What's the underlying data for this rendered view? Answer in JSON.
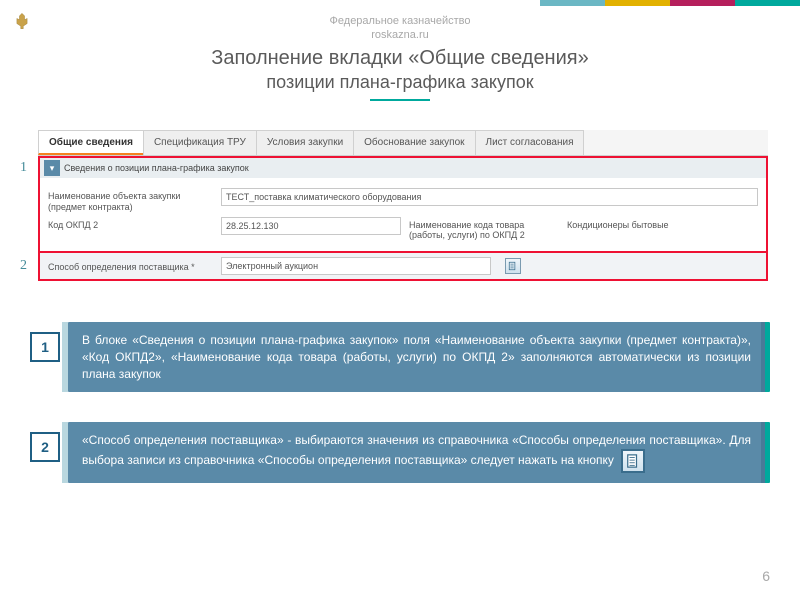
{
  "header": {
    "org": "Федеральное казначейство",
    "site": "roskazna.ru",
    "title": "Заполнение вкладки «Общие сведения»",
    "subtitle": "позиции плана-графика закупок"
  },
  "tabs": [
    "Общие сведения",
    "Спецификация ТРУ",
    "Условия закупки",
    "Обоснование закупок",
    "Лист согласования"
  ],
  "section1": {
    "header": "Сведения о позиции плана-графика закупок",
    "name_label": "Наименование объекта закупки (предмет контракта)",
    "name_value": "ТЕСТ_поставка климатического оборудования",
    "okpd_label": "Код ОКПД 2",
    "okpd_value": "28.25.12.130",
    "okpd_name_label": "Наименование кода товара (работы, услуги) по ОКПД 2",
    "okpd_name_value": "Кондиционеры бытовые"
  },
  "section2": {
    "label": "Способ определения поставщика *",
    "value": "Электронный аукцион"
  },
  "side": {
    "n1": "1",
    "n2": "2"
  },
  "callouts": {
    "c1": {
      "num": "1",
      "text": "В блоке «Сведения о позиции плана-графика закупок» поля «Наименование объекта закупки (предмет контракта)», «Код ОКПД2», «Наименование кода товара (работы, услуги) по ОКПД 2» заполняются автоматически из позиции плана закупок"
    },
    "c2": {
      "num": "2",
      "text": "«Способ определения поставщика» - выбираются значения из справочника «Способы определения поставщика». Для выбора записи из справочника «Способы определения поставщика» следует нажать на кнопку"
    }
  },
  "page_number": "6"
}
